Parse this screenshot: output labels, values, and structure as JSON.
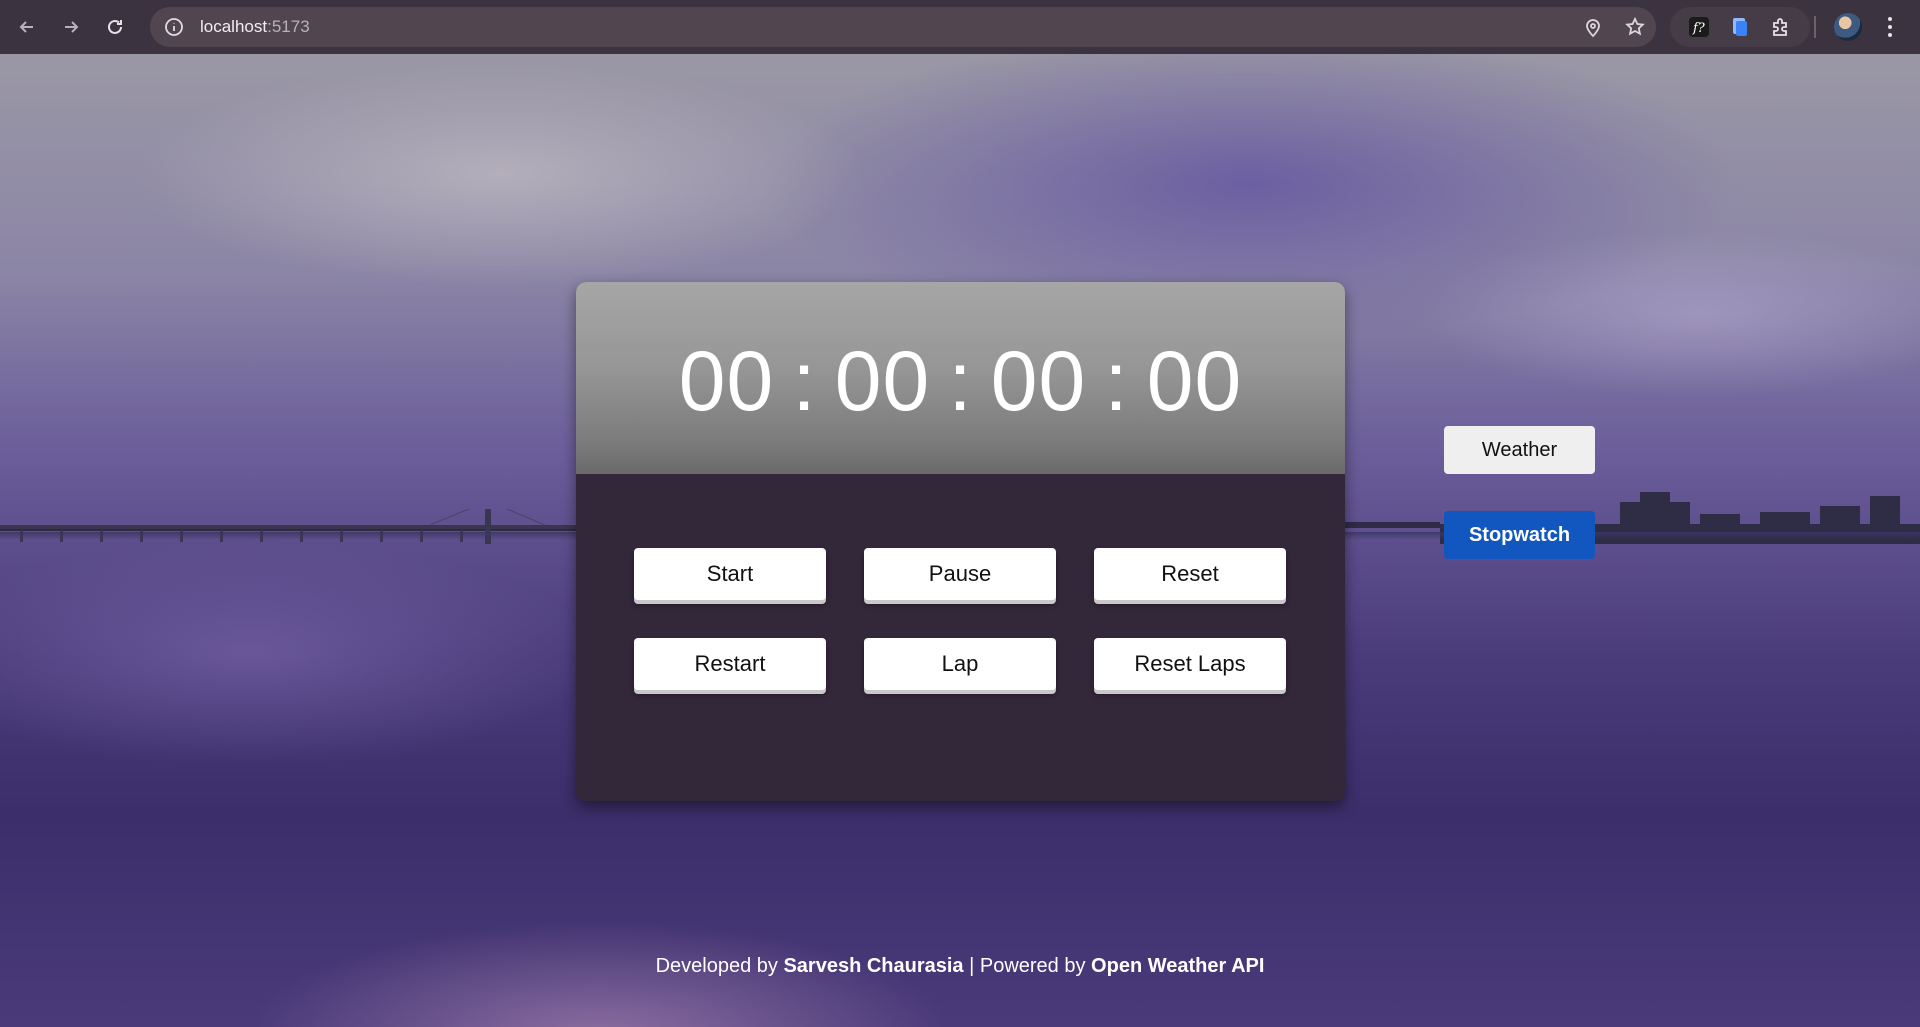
{
  "browser": {
    "url_host": "localhost",
    "url_port": ":5173"
  },
  "stopwatch": {
    "hours": "00",
    "minutes": "00",
    "seconds": "00",
    "centiseconds": "00",
    "separator": ":"
  },
  "controls": {
    "start": "Start",
    "pause": "Pause",
    "reset": "Reset",
    "restart": "Restart",
    "lap": "Lap",
    "reset_laps": "Reset Laps"
  },
  "nav": {
    "weather": "Weather",
    "stopwatch": "Stopwatch",
    "active": "stopwatch"
  },
  "footer": {
    "prefix": "Developed by ",
    "author": "Sarvesh Chaurasia",
    "middle": " | Powered by ",
    "provider": "Open Weather API"
  },
  "colors": {
    "active_nav": "#1257bf",
    "card_body": "#33273a"
  }
}
